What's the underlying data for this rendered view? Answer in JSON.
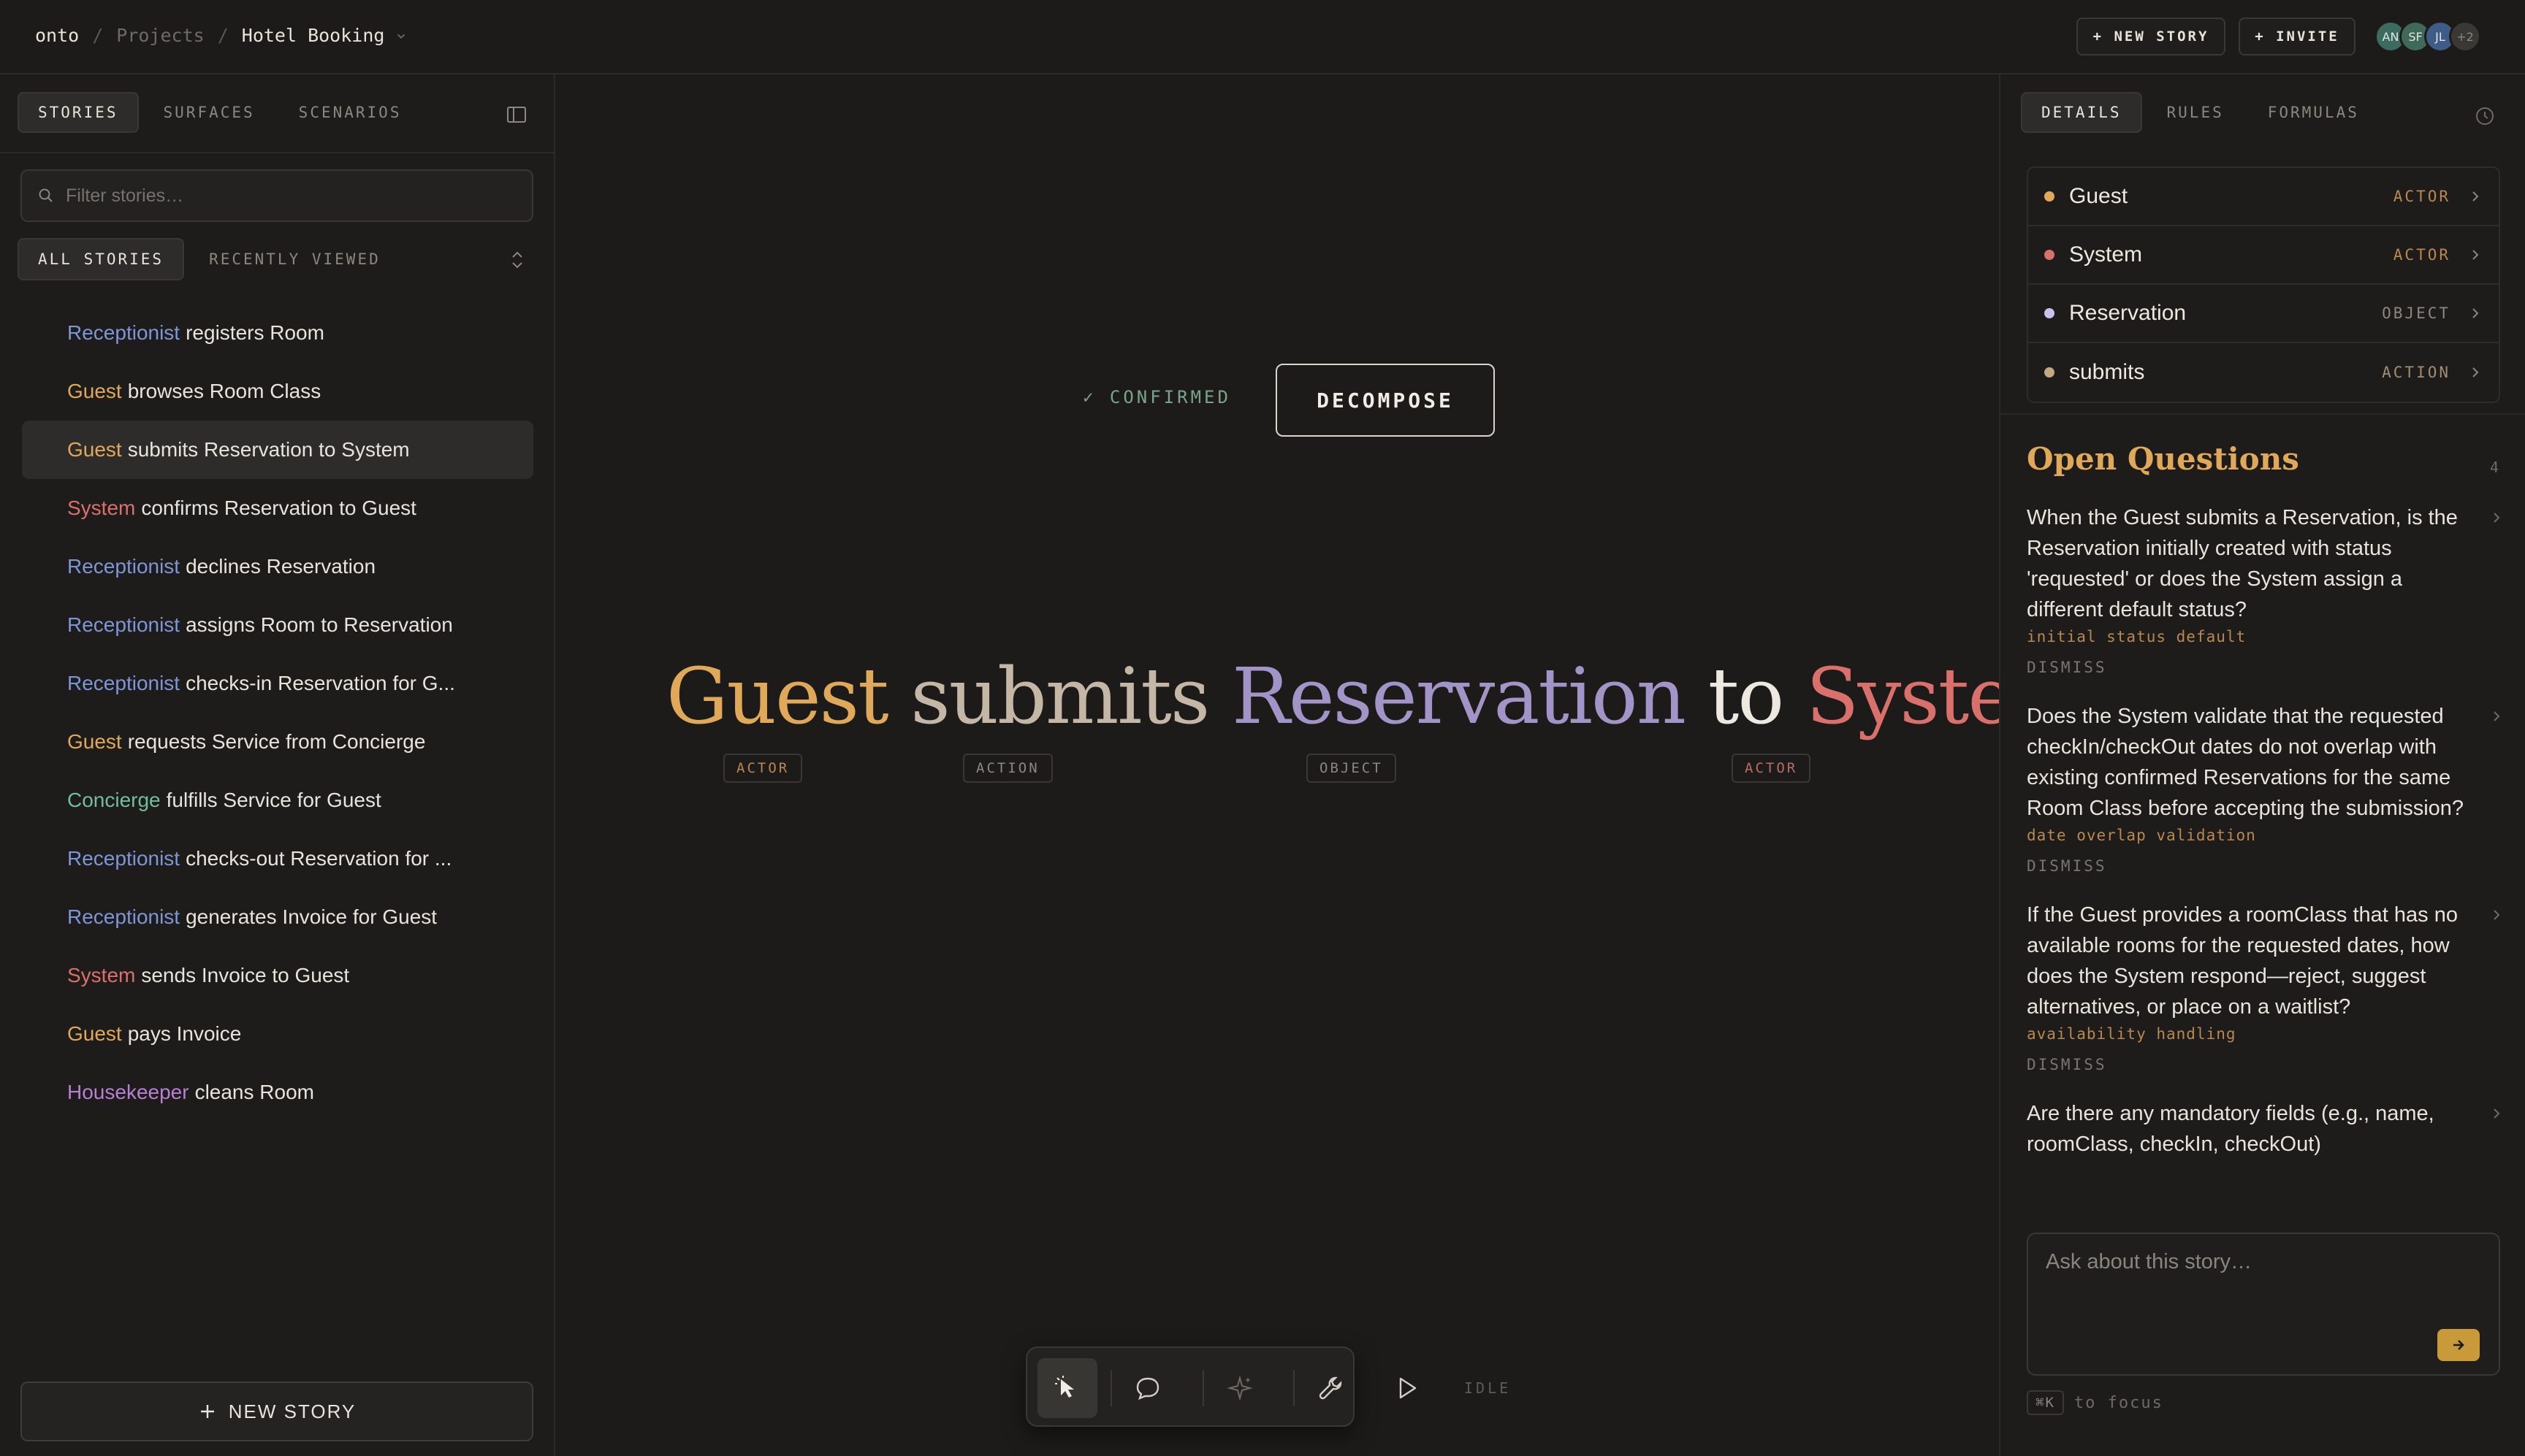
{
  "colors": {
    "actor_guest": "#e0a95a",
    "actor_system": "#d9706b",
    "actor_receptionist": "#7d96d8",
    "actor_concierge": "#6fbf9a",
    "actor_housekeeper": "#b97fd6",
    "action": "#c4b7a6",
    "object": "#a294c6",
    "accent": "#c99a3a",
    "confirmed": "#7aa48a"
  },
  "breadcrumb": {
    "root": "onto",
    "sep1": "/",
    "projects": "Projects",
    "sep2": "/",
    "project": "Hotel Booking",
    "chevron_icon": "chevron-down-icon"
  },
  "header": {
    "new_story": "+ NEW STORY",
    "invite": "+ INVITE",
    "avatars": [
      {
        "initials": "AN",
        "color": "#3c6b62"
      },
      {
        "initials": "SF",
        "color": "#3f6a5a"
      },
      {
        "initials": "JL",
        "color": "#3e5c86"
      },
      {
        "initials": "+2",
        "color": "#3a3835"
      }
    ]
  },
  "sidebar": {
    "tabs": [
      "STORIES",
      "SURFACES",
      "SCENARIOS"
    ],
    "panel_icon": "sidebar-panel-icon",
    "filter_placeholder": "Filter stories…",
    "subtabs": [
      "ALL STORIES",
      "RECENTLY VIEWED"
    ],
    "stories": [
      {
        "actor": "Receptionist",
        "rest": "registers Room",
        "role": "receptionist"
      },
      {
        "actor": "Guest",
        "rest": "browses Room Class",
        "role": "guest"
      },
      {
        "actor": "Guest",
        "rest": "submits Reservation to System",
        "role": "guest",
        "selected": true
      },
      {
        "actor": "System",
        "rest": "confirms Reservation to Guest",
        "role": "system"
      },
      {
        "actor": "Receptionist",
        "rest": "declines Reservation",
        "role": "receptionist"
      },
      {
        "actor": "Receptionist",
        "rest": "assigns Room to Reservation",
        "role": "receptionist"
      },
      {
        "actor": "Receptionist",
        "rest": "checks-in Reservation for G...",
        "role": "receptionist"
      },
      {
        "actor": "Guest",
        "rest": "requests Service from Concierge",
        "role": "guest"
      },
      {
        "actor": "Concierge",
        "rest": "fulfills Service for Guest",
        "role": "concierge"
      },
      {
        "actor": "Receptionist",
        "rest": "checks-out Reservation for ...",
        "role": "receptionist"
      },
      {
        "actor": "Receptionist",
        "rest": "generates Invoice for Guest",
        "role": "receptionist"
      },
      {
        "actor": "System",
        "rest": "sends Invoice to Guest",
        "role": "system"
      },
      {
        "actor": "Guest",
        "rest": "pays Invoice",
        "role": "guest"
      },
      {
        "actor": "Housekeeper",
        "rest": "cleans Room",
        "role": "housekeeper"
      }
    ],
    "new_story_button": "NEW STORY"
  },
  "main": {
    "confirmed": "✓ CONFIRMED",
    "decompose": "DECOMPOSE",
    "sentence": {
      "w1": "Guest",
      "w2": "submits",
      "w3": "Reservation",
      "w4": "to",
      "w5": "System"
    },
    "tags": {
      "t1": "ACTOR",
      "t2": "ACTION",
      "t3": "OBJECT",
      "t4": "ACTOR"
    },
    "toolbar": {
      "tools": [
        "select-cursor-icon",
        "comment-icon",
        "sparkle-icon",
        "wrench-icon",
        "play-icon"
      ],
      "status": "IDLE"
    }
  },
  "right": {
    "tabs": [
      "DETAILS",
      "RULES",
      "FORMULAS"
    ],
    "history_icon": "history-icon",
    "entities": [
      {
        "name": "Guest",
        "type": "ACTOR",
        "color": "#e0a95a",
        "typecolor": "#b8884e"
      },
      {
        "name": "System",
        "type": "ACTOR",
        "color": "#d9706b",
        "typecolor": "#b8884e"
      },
      {
        "name": "Reservation",
        "type": "OBJECT",
        "color": "#c8c3ea",
        "typecolor": "#8c877f"
      },
      {
        "name": "submits",
        "type": "ACTION",
        "color": "#c4a882",
        "typecolor": "#a08d74"
      }
    ],
    "open_questions_title": "Open Questions",
    "open_questions_count": "4",
    "questions": [
      {
        "text": "When the Guest submits a Reservation, is the Reservation initially created with status 'requested' or does the System assign a different default status?",
        "tag": "initial status default",
        "dismiss": "DISMISS"
      },
      {
        "text": "Does the System validate that the requested checkIn/checkOut dates do not overlap with existing confirmed Reservations for the same Room Class before accepting the submission?",
        "tag": "date overlap validation",
        "dismiss": "DISMISS"
      },
      {
        "text": "If the Guest provides a roomClass that has no available rooms for the requested dates, how does the System respond—reject, suggest alternatives, or place on a waitlist?",
        "tag": "availability handling",
        "dismiss": "DISMISS"
      },
      {
        "text": "Are there any mandatory fields (e.g., name, roomClass, checkIn, checkOut)",
        "tag": "",
        "dismiss": ""
      }
    ],
    "ask_placeholder": "Ask about this story…",
    "kbd": "⌘K",
    "kbd_hint": "to focus"
  }
}
